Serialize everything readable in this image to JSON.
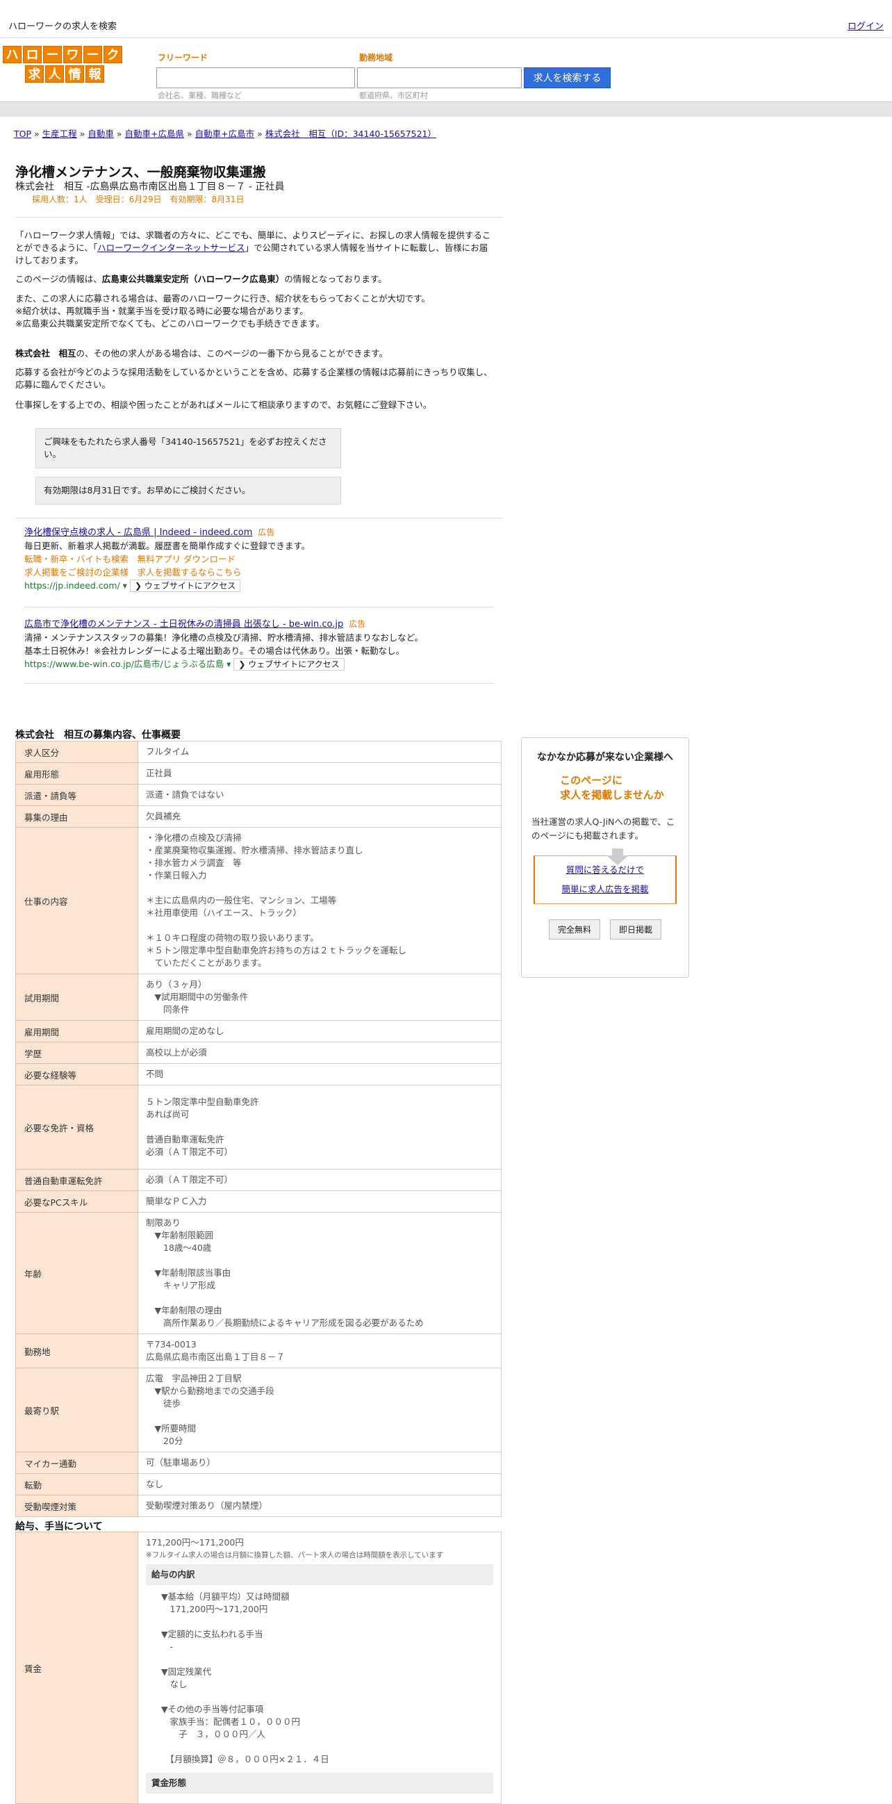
{
  "header": {
    "site_title": "ハローワークの求人を検索",
    "login": "ログイン"
  },
  "logo": {
    "row1": [
      "ハ",
      "ロ",
      "ー",
      "ワ",
      "ー",
      "ク"
    ],
    "row2": [
      "求",
      "人",
      "情",
      "報"
    ]
  },
  "search": {
    "freeword_label": "フリーワード",
    "freeword_hint": "会社名、業種、職種など",
    "area_label": "勤務地域",
    "area_hint": "都道府県、市区町村",
    "button": "求人を検索する"
  },
  "breadcrumb": [
    "TOP",
    "生産工程",
    "自動車",
    "自動車+広島県",
    "自動車+広島市",
    "株式会社　相互（ID：34140-15657521）"
  ],
  "job": {
    "title": "浄化槽メンテナンス、一般廃棄物収集運搬",
    "subtitle": "株式会社　相互 -広島県広島市南区出島１丁目８－７ - 正社員",
    "meta": "採用人数：1人　受理日：6月29日　有効期限：8月31日"
  },
  "intro": {
    "p1_a": "「ハローワーク求人情報」では、求職者の方々に、どこでも、簡単に、よりスピーディに、お探しの求人情報を提供することができるように、「",
    "p1_link": "ハローワークインターネットサービス",
    "p1_b": "」で公開されている求人情報を当サイトに転載し、皆様にお届けしております。",
    "p2_a": "このページの情報は、",
    "p2_bold": "広島東公共職業安定所（ハローワーク広島東）",
    "p2_b": "の情報となっております。",
    "p3_l1": "また、この求人に応募される場合は、最寄のハローワークに行き、紹介状をもらっておくことが大切です。",
    "p3_l2": "※紹介状は、再就職手当・就業手当を受け取る時に必要な場合があります。",
    "p3_l3": "※広島東公共職業安定所でなくても、どこのハローワークでも手続きできます。",
    "p4_bold": "株式会社　相互",
    "p4_b": "の、その他の求人がある場合は、このページの一番下から見ることができます。",
    "p5": "応募する会社が今どのような採用活動をしているかということを含め、応募する企業様の情報は応募前にきっちり収集し、応募に臨んでください。",
    "p6": "仕事探しをする上での、相談や困ったことがあればメールにて相談承りますので、お気軽にご登録下さい。"
  },
  "notices": {
    "n1": "ご興味をもたれたら求人番号「34140-15657521」を必ずお控えください。",
    "n2": "有効期限は8月31日です。お早めにご検討ください。"
  },
  "ads": [
    {
      "title": "浄化槽保守点検の求人 - 広島県 | Indeed - indeed.com",
      "badge": "広告",
      "desc": "毎日更新、新着求人掲載が満載。履歴書を簡単作成すぐに登録できます。",
      "links1": "転職・新卒・バイトも検索　無料アプリ ダウンロード",
      "links2": "求人掲載をご検討の企業様　求人を掲載するならこちら",
      "url": "https://jp.indeed.com/ ▾",
      "visit": "❯ ウェブサイトにアクセス"
    },
    {
      "title": "広島市で浄化槽のメンテナンス - 土日祝休みの清掃員 出張なし - be-win.co.jp",
      "badge": "広告",
      "desc": "清掃・メンテナンススタッフの募集！浄化槽の点検及び清掃、貯水槽清掃、排水管詰まりなおしなど。",
      "desc2": "基本土日祝休み！※会社カレンダーによる土曜出勤あり。その場合は代休あり。出張・転勤なし。",
      "url": "https://www.be-win.co.jp/広島市/じょうぶる広島 ▾",
      "visit": "❯ ウェブサイトにアクセス"
    }
  ],
  "section1_title": "株式会社　相互の募集内容、仕事概要",
  "rows": [
    {
      "k": "求人区分",
      "v": "フルタイム"
    },
    {
      "k": "雇用形態",
      "v": "正社員"
    },
    {
      "k": "派遣・請負等",
      "v": "派遣・請負ではない"
    },
    {
      "k": "募集の理由",
      "v": "欠員補充"
    },
    {
      "k": "仕事の内容",
      "v": "・浄化槽の点検及び清掃\n・産業廃棄物収集運搬、貯水槽清掃、排水管詰まり直し\n・排水管カメラ調査　等\n・作業日報入力\n\n＊主に広島県内の一般住宅、マンション、工場等\n＊社用車使用（ハイエース、トラック）\n\n＊１０キロ程度の荷物の取り扱いあります。\n＊５トン限定準中型自動車免許お持ちの方は２ｔトラックを運転し\n　ていただくことがあります。"
    },
    {
      "k": "試用期間",
      "v": "あり（３ヶ月）\n　▼試用期間中の労働条件\n　　同条件"
    },
    {
      "k": "雇用期間",
      "v": "雇用期間の定めなし"
    },
    {
      "k": "学歴",
      "v": "高校以上が必須"
    },
    {
      "k": "必要な経験等",
      "v": "不問"
    },
    {
      "k": "必要な免許・資格",
      "v": "５トン限定準中型自動車免許\nあれば尚可\n\n普通自動車運転免許\n必須（ＡＴ限定不可）"
    },
    {
      "k": "普通自動車運転免許",
      "v": "必須（ＡＴ限定不可）"
    },
    {
      "k": "必要なPCスキル",
      "v": "簡単なＰＣ入力"
    },
    {
      "k": "年齢",
      "v": "制限あり\n　▼年齢制限範囲\n　　18歳〜40歳\n\n　▼年齢制限該当事由\n　　キャリア形成\n\n　▼年齢制限の理由\n　　高所作業あり／長期勤続によるキャリア形成を図る必要があるため"
    },
    {
      "k": "勤務地",
      "v": "〒734-0013\n広島県広島市南区出島１丁目８－７"
    },
    {
      "k": "最寄り駅",
      "v": "広電　宇品神田２丁目駅\n　▼駅から勤務地までの交通手段\n　　徒歩\n\n　▼所要時間\n　　20分"
    },
    {
      "k": "マイカー通勤",
      "v": "可（駐車場あり）"
    },
    {
      "k": "転勤",
      "v": "なし"
    },
    {
      "k": "受動喫煙対策",
      "v": "受動喫煙対策あり（屋内禁煙）"
    }
  ],
  "section2_title": "給与、手当について",
  "wage": {
    "label": "賃金",
    "range": "171,200円〜171,200円",
    "note": "※フルタイム求人の場合は月額に換算した額、パート求人の場合は時間額を表示しています",
    "breakdown_title": "給与の内訳",
    "breakdown": "▼基本給（月額平均）又は時間額\n　171,200円〜171,200円\n\n▼定額的に支払われる手当\n　-\n\n▼固定残業代\n　なし\n\n▼その他の手当等付記事項\n　家族手当：配偶者１０，０００円\n　　子　３，０００円／人\n\n　【月額換算】＠８，０００円×２１．４日",
    "form_title": "賃金形態"
  },
  "side": {
    "title": "なかなか応募が来ない企業様へ",
    "catch1": "このページに",
    "catch2": "求人を掲載しませんか",
    "desc": "当社運営の求人Q-JiNへの掲載で、このページにも掲載されます。",
    "link1": "質問に答えるだけで",
    "link2": "簡単に求人広告を掲載",
    "btn1": "完全無料",
    "btn2": "即日掲載"
  }
}
